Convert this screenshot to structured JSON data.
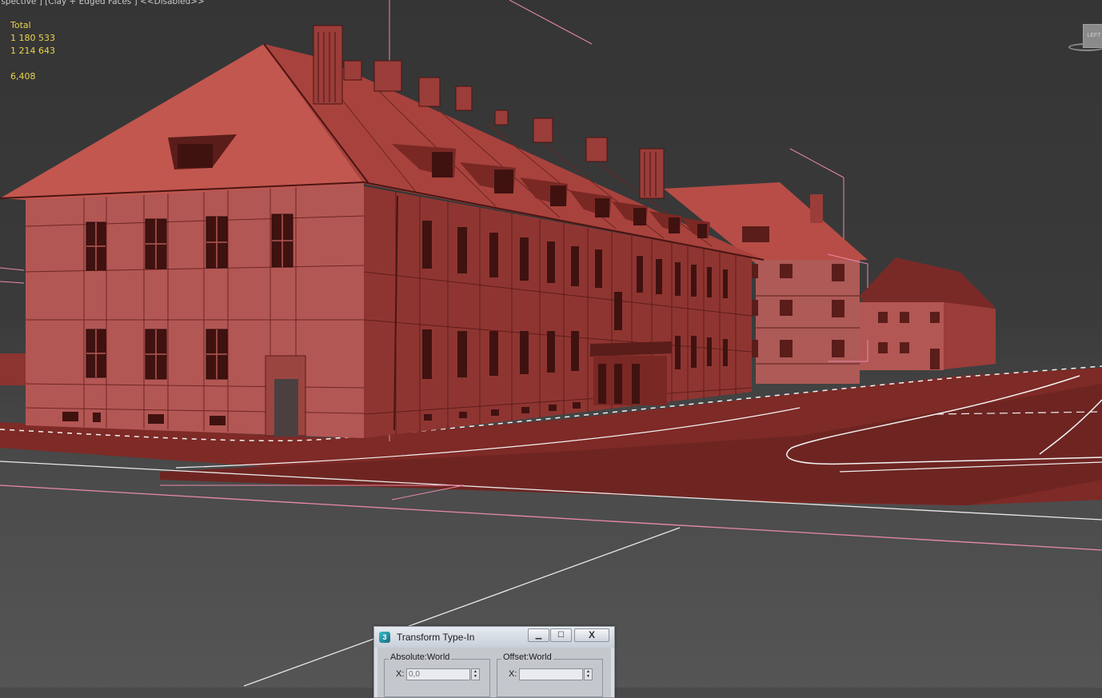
{
  "viewport": {
    "label": "rspective ] [Clay + Edged Faces ]  <<Disabled>>",
    "stats": {
      "total_label": "Total",
      "polys": "1 180 533",
      "verts": "1 214 643",
      "fps": "6,408"
    },
    "viewcube_label": "LEFT"
  },
  "dialog": {
    "title": "Transform Type-In",
    "minimize_glyph": "▁",
    "maximize_glyph": "☐",
    "close_glyph": "X",
    "absolute_label": "Absolute:World",
    "offset_label": "Offset:World",
    "abs_x_label": "X:",
    "abs_x_value": "0,0",
    "off_x_label": "X:",
    "off_x_value": ""
  },
  "colors": {
    "clay": "#b0504a",
    "clay_dark": "#7f2d28",
    "wire_pink": "#e98aa8",
    "stats_yellow": "#e8d54a"
  }
}
